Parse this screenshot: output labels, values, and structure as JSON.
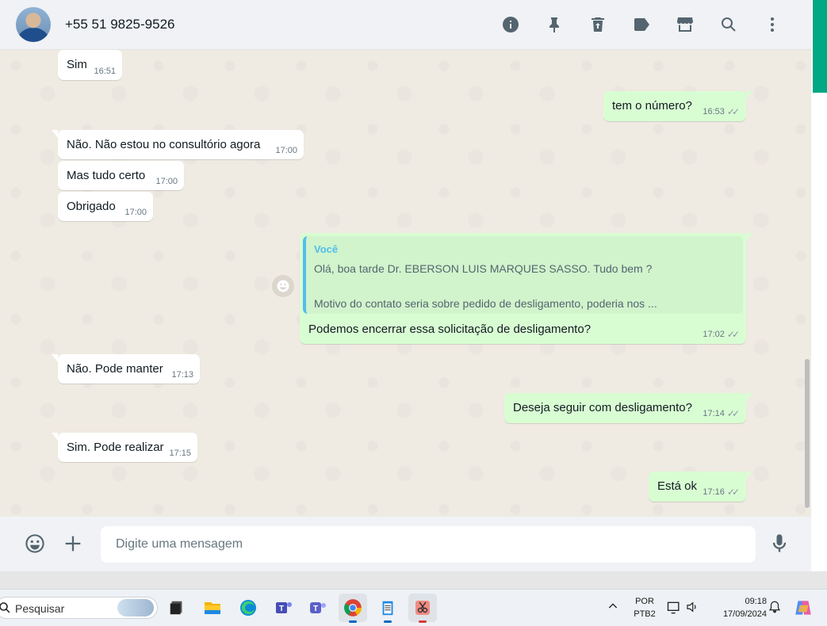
{
  "header": {
    "contact_name": "+55 51 9825-9526",
    "icons": [
      "info-icon",
      "pin-icon",
      "delete-icon",
      "label-icon",
      "shop-icon",
      "search-icon",
      "menu-icon"
    ]
  },
  "messages": [
    {
      "dir": "in",
      "text": "Sim",
      "time": "16:51"
    },
    {
      "dir": "out",
      "text": "tem o número?",
      "time": "16:53"
    },
    {
      "dir": "in",
      "text": "Não. Não estou no consultório agora",
      "time": "17:00"
    },
    {
      "dir": "in",
      "text": "Mas tudo certo",
      "time": "17:00"
    },
    {
      "dir": "in",
      "text": "Obrigado",
      "time": "17:00"
    },
    {
      "dir": "out",
      "quote_author": "Você",
      "quote_line1": "Olá, boa tarde Dr.  EBERSON LUIS MARQUES SASSO. Tudo bem ?",
      "quote_line2": "Motivo do contato seria sobre pedido de desligamento, poderia nos ...",
      "text": "Podemos encerrar essa solicitação de desligamento?",
      "time": "17:02"
    },
    {
      "dir": "in",
      "text": "Não. Pode manter",
      "time": "17:13"
    },
    {
      "dir": "out",
      "text": "Deseja seguir com desligamento?",
      "time": "17:14"
    },
    {
      "dir": "in",
      "text": "Sim. Pode realizar",
      "time": "17:15"
    },
    {
      "dir": "out",
      "text": "Está ok",
      "time": "17:16"
    }
  ],
  "composer": {
    "placeholder": "Digite uma mensagem",
    "icons": [
      "emoji-icon",
      "plus-icon",
      "mic-icon"
    ]
  },
  "taskbar": {
    "search_placeholder": "Pesquisar",
    "apps": [
      "desktop-app",
      "file-explorer",
      "edge-browser",
      "teams-classic",
      "teams",
      "chrome",
      "notepad",
      "snipping-tool"
    ],
    "language_line1": "POR",
    "language_line2": "PTB2",
    "time": "09:18",
    "date": "17/09/2024"
  }
}
